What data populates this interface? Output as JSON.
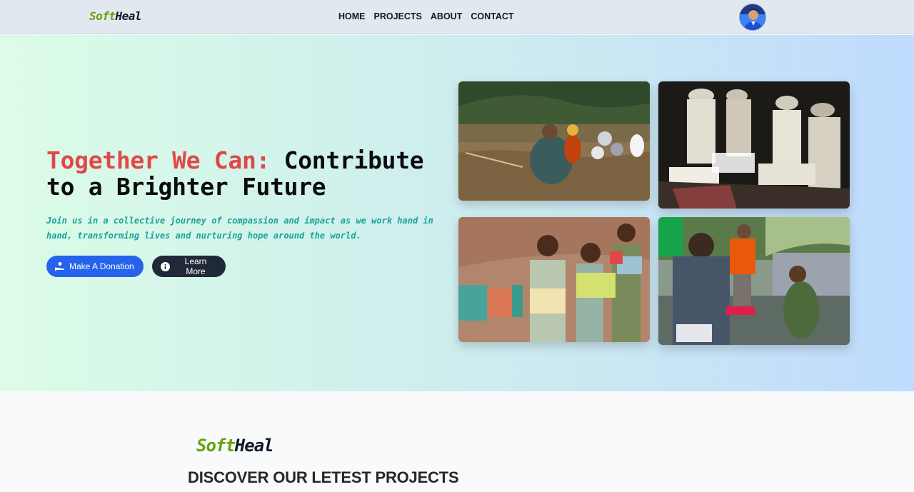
{
  "nav": {
    "logo_part1": "Soft",
    "logo_part2": "Heal",
    "links": [
      "HOME",
      "PROJECTS",
      "ABOUT",
      "CONTACT"
    ]
  },
  "hero": {
    "headline_highlight": "Together We Can:",
    "headline_rest": " Contribute to a Brighter Future",
    "subtext": "Join us in a collective journey of compassion and impact as we work hand in hand, transforming lives and nurturing hope around the world.",
    "donate_label": "Make A Donation",
    "learn_label": "Learn More",
    "photos": [
      "flood-rescue-photo",
      "prayer-reading-photo",
      "children-books-photo",
      "aid-distribution-photo"
    ]
  },
  "projects": {
    "logo_part1": "Soft",
    "logo_part2": "Heal",
    "title": "DISCOVER OUR LETEST PROJECTS"
  },
  "colors": {
    "accent_green": "#65a30d",
    "headline_red": "#e04848",
    "subtext_teal": "#1aa39a",
    "donate_blue": "#2563eb",
    "learn_dark": "#1f2937"
  }
}
